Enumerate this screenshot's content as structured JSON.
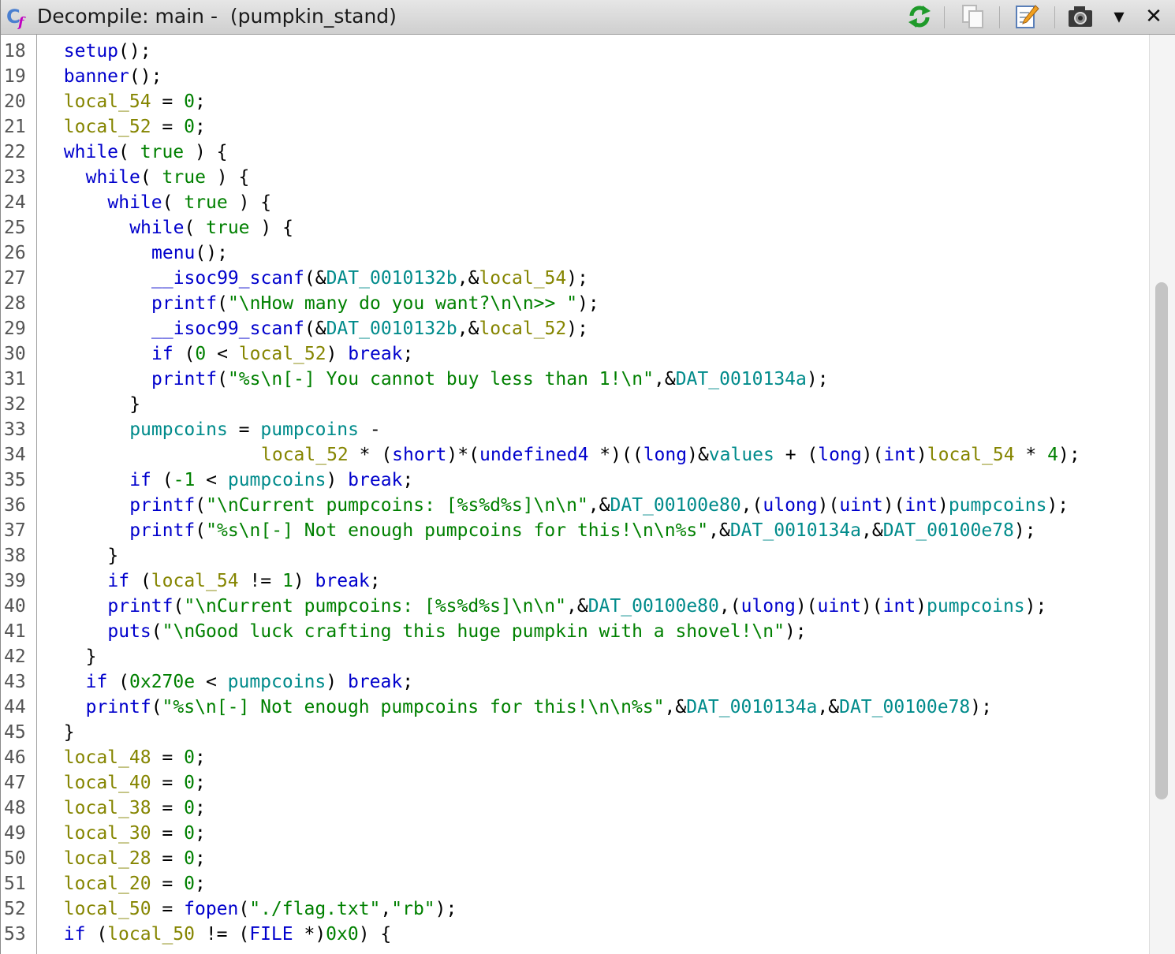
{
  "window": {
    "title": "Decompile: main -  (pumpkin_stand)"
  },
  "toolbar": {
    "icons": [
      "refresh-icon",
      "copy-icon",
      "edit-icon",
      "snapshot-camera-icon",
      "dropdown-arrow-icon",
      "close-icon"
    ],
    "close_glyph": "✕",
    "menu_glyph": "▼"
  },
  "colors": {
    "keyword": "#0000cc",
    "local_var": "#858500",
    "global_var": "#008b8b",
    "string_and_number": "#008000"
  },
  "code": {
    "lines": [
      {
        "n": "18",
        "indent": 2,
        "toks": [
          [
            "fn",
            "setup"
          ],
          [
            "p",
            "();"
          ]
        ]
      },
      {
        "n": "19",
        "indent": 2,
        "toks": [
          [
            "fn",
            "banner"
          ],
          [
            "p",
            "();"
          ]
        ]
      },
      {
        "n": "20",
        "indent": 2,
        "toks": [
          [
            "lv",
            "local_54"
          ],
          [
            "p",
            " = "
          ],
          [
            "num",
            "0"
          ],
          [
            "p",
            ";"
          ]
        ]
      },
      {
        "n": "21",
        "indent": 2,
        "toks": [
          [
            "lv",
            "local_52"
          ],
          [
            "p",
            " = "
          ],
          [
            "num",
            "0"
          ],
          [
            "p",
            ";"
          ]
        ]
      },
      {
        "n": "22",
        "indent": 2,
        "toks": [
          [
            "kw",
            "while"
          ],
          [
            "p",
            "( "
          ],
          [
            "num",
            "true"
          ],
          [
            "p",
            " ) {"
          ]
        ]
      },
      {
        "n": "23",
        "indent": 4,
        "toks": [
          [
            "kw",
            "while"
          ],
          [
            "p",
            "( "
          ],
          [
            "num",
            "true"
          ],
          [
            "p",
            " ) {"
          ]
        ]
      },
      {
        "n": "24",
        "indent": 6,
        "toks": [
          [
            "kw",
            "while"
          ],
          [
            "p",
            "( "
          ],
          [
            "num",
            "true"
          ],
          [
            "p",
            " ) {"
          ]
        ]
      },
      {
        "n": "25",
        "indent": 8,
        "toks": [
          [
            "kw",
            "while"
          ],
          [
            "p",
            "( "
          ],
          [
            "num",
            "true"
          ],
          [
            "p",
            " ) {"
          ]
        ]
      },
      {
        "n": "26",
        "indent": 10,
        "toks": [
          [
            "fn",
            "menu"
          ],
          [
            "p",
            "();"
          ]
        ]
      },
      {
        "n": "27",
        "indent": 10,
        "toks": [
          [
            "fn",
            "__isoc99_scanf"
          ],
          [
            "p",
            "(&"
          ],
          [
            "gv",
            "DAT_0010132b"
          ],
          [
            "p",
            ",&"
          ],
          [
            "lv",
            "local_54"
          ],
          [
            "p",
            ");"
          ]
        ]
      },
      {
        "n": "28",
        "indent": 10,
        "toks": [
          [
            "fn",
            "printf"
          ],
          [
            "p",
            "("
          ],
          [
            "str",
            "\"\\nHow many do you want?\\n\\n>> \""
          ],
          [
            "p",
            ");"
          ]
        ]
      },
      {
        "n": "29",
        "indent": 10,
        "toks": [
          [
            "fn",
            "__isoc99_scanf"
          ],
          [
            "p",
            "(&"
          ],
          [
            "gv",
            "DAT_0010132b"
          ],
          [
            "p",
            ",&"
          ],
          [
            "lv",
            "local_52"
          ],
          [
            "p",
            ");"
          ]
        ]
      },
      {
        "n": "30",
        "indent": 10,
        "toks": [
          [
            "kw",
            "if"
          ],
          [
            "p",
            " ("
          ],
          [
            "num",
            "0"
          ],
          [
            "p",
            " < "
          ],
          [
            "lv",
            "local_52"
          ],
          [
            "p",
            ") "
          ],
          [
            "kw",
            "break"
          ],
          [
            "p",
            ";"
          ]
        ]
      },
      {
        "n": "31",
        "indent": 10,
        "toks": [
          [
            "fn",
            "printf"
          ],
          [
            "p",
            "("
          ],
          [
            "str",
            "\"%s\\n[-] You cannot buy less than 1!\\n\""
          ],
          [
            "p",
            ",&"
          ],
          [
            "gv",
            "DAT_0010134a"
          ],
          [
            "p",
            ");"
          ]
        ]
      },
      {
        "n": "32",
        "indent": 8,
        "toks": [
          [
            "p",
            "}"
          ]
        ]
      },
      {
        "n": "33",
        "indent": 8,
        "toks": [
          [
            "gv",
            "pumpcoins"
          ],
          [
            "p",
            " = "
          ],
          [
            "gv",
            "pumpcoins"
          ],
          [
            "p",
            " -"
          ]
        ]
      },
      {
        "n": "34",
        "indent": 20,
        "toks": [
          [
            "lv",
            "local_52"
          ],
          [
            "p",
            " * ("
          ],
          [
            "ty",
            "short"
          ],
          [
            "p",
            ")*("
          ],
          [
            "ty",
            "undefined4"
          ],
          [
            "p",
            " *)(("
          ],
          [
            "ty",
            "long"
          ],
          [
            "p",
            ")&"
          ],
          [
            "gv",
            "values"
          ],
          [
            "p",
            " + ("
          ],
          [
            "ty",
            "long"
          ],
          [
            "p",
            ")("
          ],
          [
            "ty",
            "int"
          ],
          [
            "p",
            ")"
          ],
          [
            "lv",
            "local_54"
          ],
          [
            "p",
            " * "
          ],
          [
            "num",
            "4"
          ],
          [
            "p",
            ");"
          ]
        ]
      },
      {
        "n": "35",
        "indent": 8,
        "toks": [
          [
            "kw",
            "if"
          ],
          [
            "p",
            " ("
          ],
          [
            "num",
            "-1"
          ],
          [
            "p",
            " < "
          ],
          [
            "gv",
            "pumpcoins"
          ],
          [
            "p",
            ") "
          ],
          [
            "kw",
            "break"
          ],
          [
            "p",
            ";"
          ]
        ]
      },
      {
        "n": "36",
        "indent": 8,
        "toks": [
          [
            "fn",
            "printf"
          ],
          [
            "p",
            "("
          ],
          [
            "str",
            "\"\\nCurrent pumpcoins: [%s%d%s]\\n\\n\""
          ],
          [
            "p",
            ",&"
          ],
          [
            "gv",
            "DAT_00100e80"
          ],
          [
            "p",
            ",("
          ],
          [
            "ty",
            "ulong"
          ],
          [
            "p",
            ")("
          ],
          [
            "ty",
            "uint"
          ],
          [
            "p",
            ")("
          ],
          [
            "ty",
            "int"
          ],
          [
            "p",
            ")"
          ],
          [
            "gv",
            "pumpcoins"
          ],
          [
            "p",
            ");"
          ]
        ]
      },
      {
        "n": "37",
        "indent": 8,
        "toks": [
          [
            "fn",
            "printf"
          ],
          [
            "p",
            "("
          ],
          [
            "str",
            "\"%s\\n[-] Not enough pumpcoins for this!\\n\\n%s\""
          ],
          [
            "p",
            ",&"
          ],
          [
            "gv",
            "DAT_0010134a"
          ],
          [
            "p",
            ",&"
          ],
          [
            "gv",
            "DAT_00100e78"
          ],
          [
            "p",
            ");"
          ]
        ]
      },
      {
        "n": "38",
        "indent": 6,
        "toks": [
          [
            "p",
            "}"
          ]
        ]
      },
      {
        "n": "39",
        "indent": 6,
        "toks": [
          [
            "kw",
            "if"
          ],
          [
            "p",
            " ("
          ],
          [
            "lv",
            "local_54"
          ],
          [
            "p",
            " != "
          ],
          [
            "num",
            "1"
          ],
          [
            "p",
            ") "
          ],
          [
            "kw",
            "break"
          ],
          [
            "p",
            ";"
          ]
        ]
      },
      {
        "n": "40",
        "indent": 6,
        "toks": [
          [
            "fn",
            "printf"
          ],
          [
            "p",
            "("
          ],
          [
            "str",
            "\"\\nCurrent pumpcoins: [%s%d%s]\\n\\n\""
          ],
          [
            "p",
            ",&"
          ],
          [
            "gv",
            "DAT_00100e80"
          ],
          [
            "p",
            ",("
          ],
          [
            "ty",
            "ulong"
          ],
          [
            "p",
            ")("
          ],
          [
            "ty",
            "uint"
          ],
          [
            "p",
            ")("
          ],
          [
            "ty",
            "int"
          ],
          [
            "p",
            ")"
          ],
          [
            "gv",
            "pumpcoins"
          ],
          [
            "p",
            ");"
          ]
        ]
      },
      {
        "n": "41",
        "indent": 6,
        "toks": [
          [
            "fn",
            "puts"
          ],
          [
            "p",
            "("
          ],
          [
            "str",
            "\"\\nGood luck crafting this huge pumpkin with a shovel!\\n\""
          ],
          [
            "p",
            ");"
          ]
        ]
      },
      {
        "n": "42",
        "indent": 4,
        "toks": [
          [
            "p",
            "}"
          ]
        ]
      },
      {
        "n": "43",
        "indent": 4,
        "toks": [
          [
            "kw",
            "if"
          ],
          [
            "p",
            " ("
          ],
          [
            "num",
            "0x270e"
          ],
          [
            "p",
            " < "
          ],
          [
            "gv",
            "pumpcoins"
          ],
          [
            "p",
            ") "
          ],
          [
            "kw",
            "break"
          ],
          [
            "p",
            ";"
          ]
        ]
      },
      {
        "n": "44",
        "indent": 4,
        "toks": [
          [
            "fn",
            "printf"
          ],
          [
            "p",
            "("
          ],
          [
            "str",
            "\"%s\\n[-] Not enough pumpcoins for this!\\n\\n%s\""
          ],
          [
            "p",
            ",&"
          ],
          [
            "gv",
            "DAT_0010134a"
          ],
          [
            "p",
            ",&"
          ],
          [
            "gv",
            "DAT_00100e78"
          ],
          [
            "p",
            ");"
          ]
        ]
      },
      {
        "n": "45",
        "indent": 2,
        "toks": [
          [
            "p",
            "}"
          ]
        ]
      },
      {
        "n": "46",
        "indent": 2,
        "toks": [
          [
            "lv",
            "local_48"
          ],
          [
            "p",
            " = "
          ],
          [
            "num",
            "0"
          ],
          [
            "p",
            ";"
          ]
        ]
      },
      {
        "n": "47",
        "indent": 2,
        "toks": [
          [
            "lv",
            "local_40"
          ],
          [
            "p",
            " = "
          ],
          [
            "num",
            "0"
          ],
          [
            "p",
            ";"
          ]
        ]
      },
      {
        "n": "48",
        "indent": 2,
        "toks": [
          [
            "lv",
            "local_38"
          ],
          [
            "p",
            " = "
          ],
          [
            "num",
            "0"
          ],
          [
            "p",
            ";"
          ]
        ]
      },
      {
        "n": "49",
        "indent": 2,
        "toks": [
          [
            "lv",
            "local_30"
          ],
          [
            "p",
            " = "
          ],
          [
            "num",
            "0"
          ],
          [
            "p",
            ";"
          ]
        ]
      },
      {
        "n": "50",
        "indent": 2,
        "toks": [
          [
            "lv",
            "local_28"
          ],
          [
            "p",
            " = "
          ],
          [
            "num",
            "0"
          ],
          [
            "p",
            ";"
          ]
        ]
      },
      {
        "n": "51",
        "indent": 2,
        "toks": [
          [
            "lv",
            "local_20"
          ],
          [
            "p",
            " = "
          ],
          [
            "num",
            "0"
          ],
          [
            "p",
            ";"
          ]
        ]
      },
      {
        "n": "52",
        "indent": 2,
        "toks": [
          [
            "lv",
            "local_50"
          ],
          [
            "p",
            " = "
          ],
          [
            "fn",
            "fopen"
          ],
          [
            "p",
            "("
          ],
          [
            "str",
            "\"./flag.txt\""
          ],
          [
            "p",
            ","
          ],
          [
            "str",
            "\"rb\""
          ],
          [
            "p",
            ");"
          ]
        ]
      },
      {
        "n": "53",
        "indent": 2,
        "toks": [
          [
            "kw",
            "if"
          ],
          [
            "p",
            " ("
          ],
          [
            "lv",
            "local_50"
          ],
          [
            "p",
            " != ("
          ],
          [
            "ty",
            "FILE"
          ],
          [
            "p",
            " *)"
          ],
          [
            "num",
            "0x0"
          ],
          [
            "p",
            ") {"
          ]
        ]
      }
    ]
  }
}
